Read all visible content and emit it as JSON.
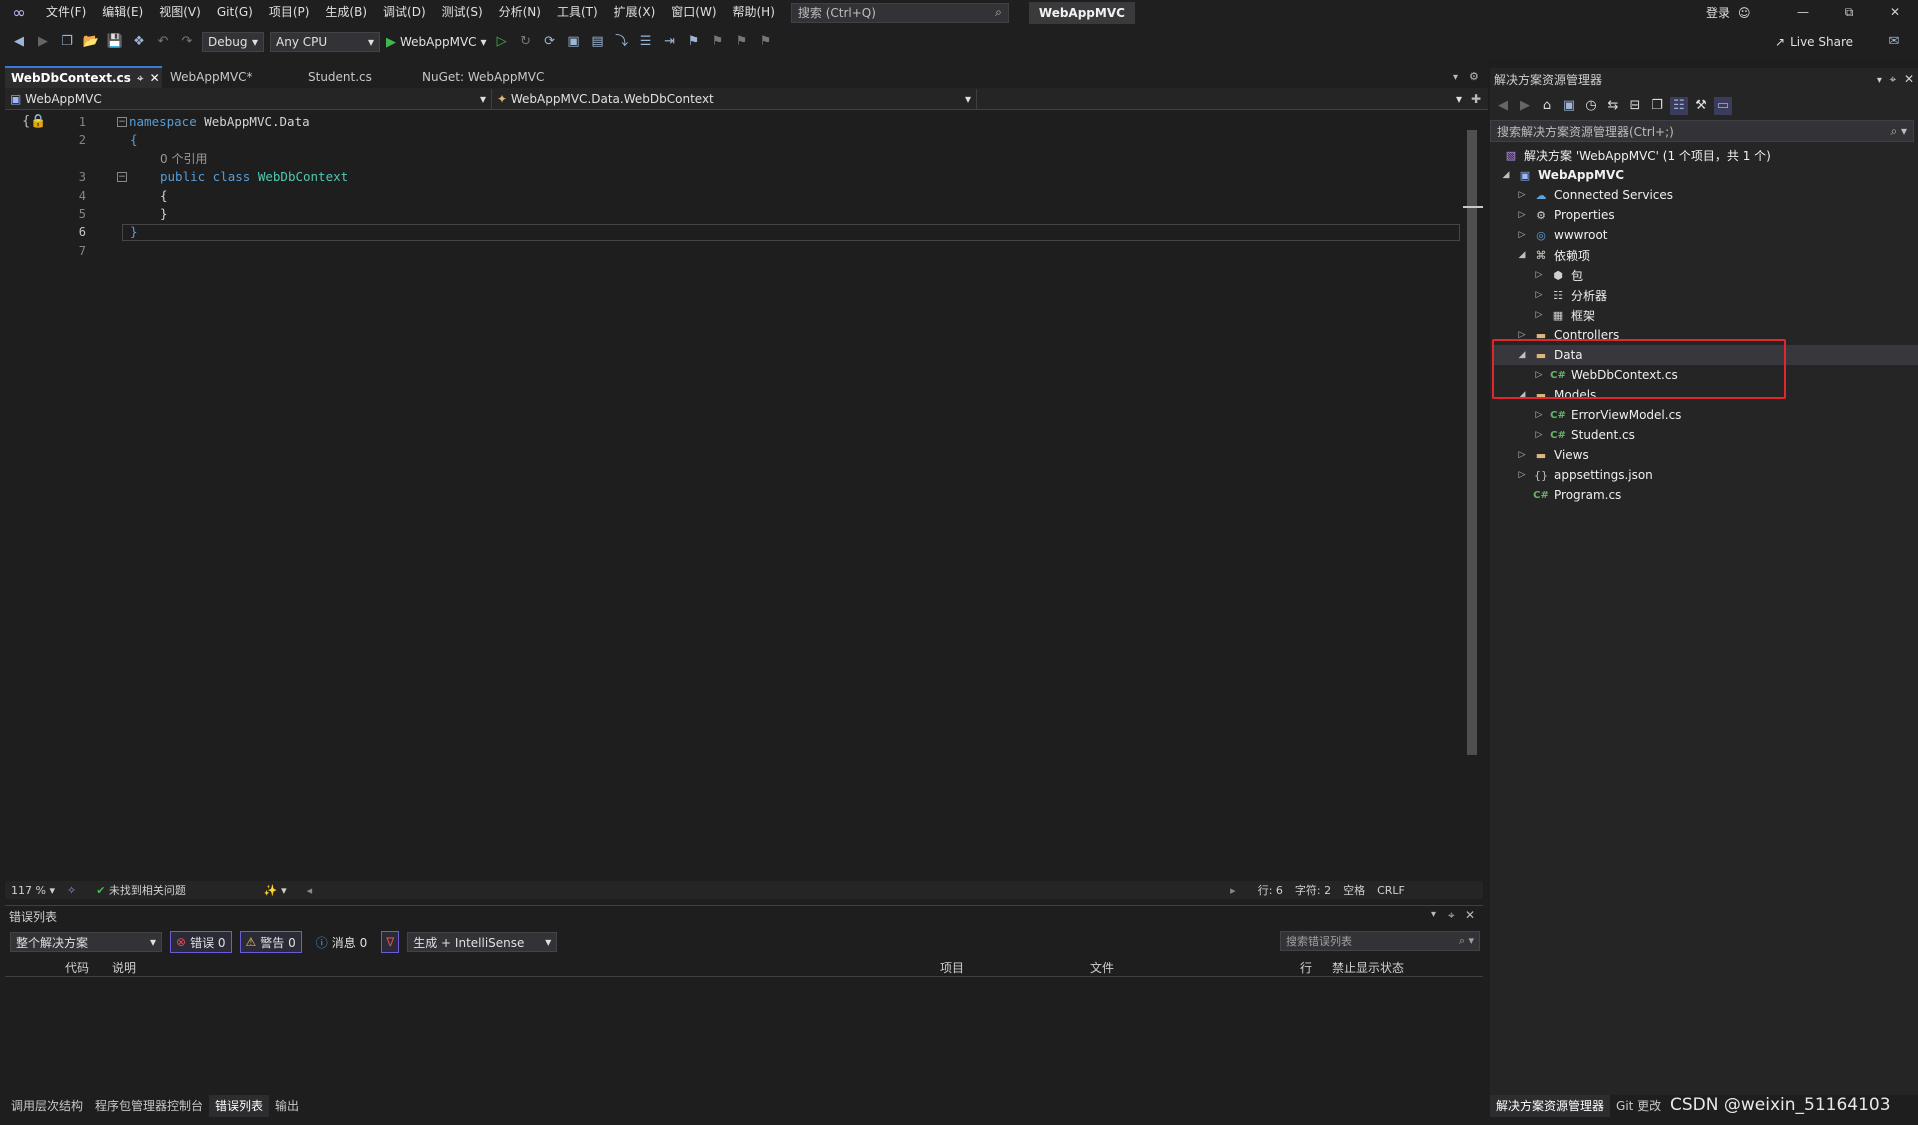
{
  "menubar": {
    "items": [
      "文件(F)",
      "编辑(E)",
      "视图(V)",
      "Git(G)",
      "项目(P)",
      "生成(B)",
      "调试(D)",
      "测试(S)",
      "分析(N)",
      "工具(T)",
      "扩展(X)",
      "窗口(W)",
      "帮助(H)"
    ],
    "search_placeholder": "搜索 (Ctrl+Q)",
    "app_title": "WebAppMVC",
    "login": "登录"
  },
  "toolbar": {
    "config": "Debug",
    "platform": "Any CPU",
    "run_target": "WebAppMVC",
    "live_share": "Live Share"
  },
  "doc_tabs": [
    {
      "label": "WebDbContext.cs",
      "active": true
    },
    {
      "label": "WebAppMVC*",
      "active": false
    },
    {
      "label": "Student.cs",
      "active": false
    },
    {
      "label": "NuGet: WebAppMVC",
      "active": false
    }
  ],
  "navbar": {
    "project": "WebAppMVC",
    "type": "WebAppMVC.Data.WebDbContext"
  },
  "editor": {
    "line_numbers": [
      "1",
      "2",
      "3",
      "4",
      "5",
      "6",
      "7"
    ],
    "code": {
      "l1_kw": "namespace",
      "l1_rest": " WebAppMVC.Data",
      "l2": "{",
      "ref_hint": "0 个引用",
      "l3_kw": "public class",
      "l3_type": " WebDbContext",
      "l4": "{",
      "l5": "}",
      "l6": "}"
    },
    "current_line": "6"
  },
  "editor_status": {
    "zoom": "117 %",
    "issues": "未找到相关问题",
    "line": "行: 6",
    "char": "字符: 2",
    "whitespace": "空格",
    "eol": "CRLF"
  },
  "error_list": {
    "title": "错误列表",
    "scope": "整个解决方案",
    "errors": "错误 0",
    "warnings": "警告 0",
    "messages": "消息 0",
    "source": "生成 + IntelliSense",
    "search_placeholder": "搜索错误列表",
    "columns": [
      "代码",
      "说明",
      "项目",
      "文件",
      "行",
      "禁止显示状态"
    ]
  },
  "bottom_tabs": [
    "调用层次结构",
    "程序包管理器控制台",
    "错误列表",
    "输出"
  ],
  "solution_explorer": {
    "title": "解决方案资源管理器",
    "search_placeholder": "搜索解决方案资源管理器(Ctrl+;)",
    "solution": "解决方案 'WebAppMVC' (1 个项目，共 1 个)",
    "project": "WebAppMVC",
    "items": {
      "connected": "Connected Services",
      "properties": "Properties",
      "wwwroot": "wwwroot",
      "deps": "依赖项",
      "pkg": "包",
      "analyzers": "分析器",
      "frameworks": "框架",
      "controllers": "Controllers",
      "data": "Data",
      "webdbcontext": "WebDbContext.cs",
      "models": "Models",
      "errorviewmodel": "ErrorViewModel.cs",
      "student": "Student.cs",
      "views": "Views",
      "appsettings": "appsettings.json",
      "program": "Program.cs"
    },
    "bottom_tabs": [
      "解决方案资源管理器",
      "Git 更改"
    ]
  },
  "watermark": "CSDN @weixin_51164103",
  "colors": {
    "background": "#1e1e1e",
    "keyword": "#569cd6",
    "type": "#4ec9b0",
    "highlight": "#e3262d"
  }
}
